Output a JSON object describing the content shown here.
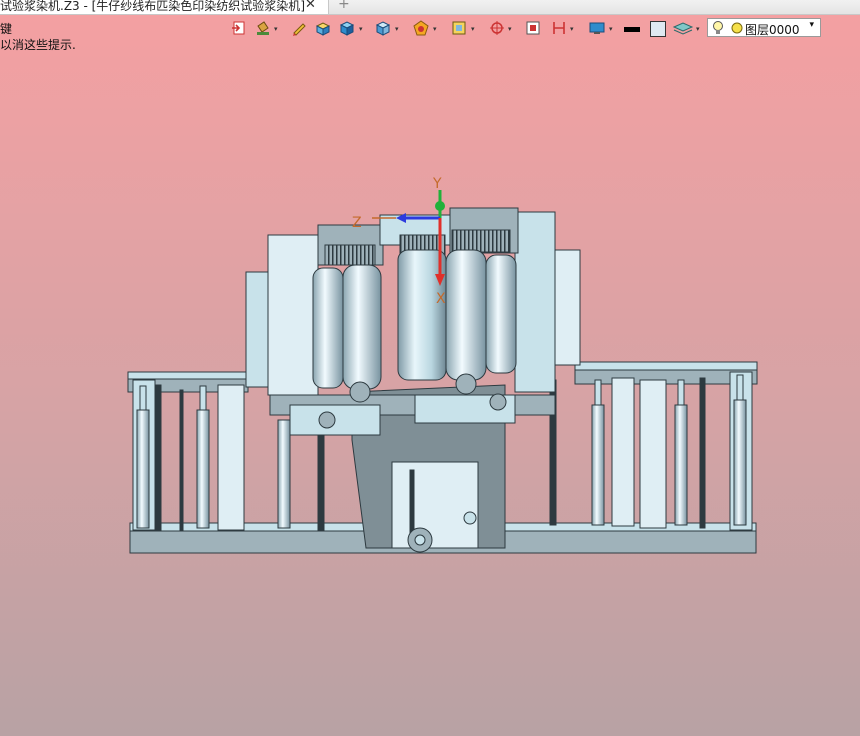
{
  "tab": {
    "title": "试验浆染机.Z3 - [牛仔纱线布匹染色印染纺织试验浆染机]",
    "close_glyph": "✕",
    "add_glyph": "+"
  },
  "hints": {
    "line1": "键",
    "line2": "以消这些提示."
  },
  "toolbar": {
    "layer_name": "图层0000",
    "dropdown_glyph": "▾",
    "icons": [
      "exit-icon",
      "paint-bucket-icon",
      "pencil-icon",
      "render-box-icon",
      "solid-cube-icon",
      "shaded-cube-icon",
      "wheel-icon",
      "frame-icon",
      "target-icon",
      "measure-icon",
      "align-icon",
      "display-icon",
      "line-color",
      "fill-color",
      "layer-stack-icon",
      "lightbulb-icon",
      "layer-color-dot"
    ]
  },
  "triad": {
    "x_label": "X",
    "y_label": "Y",
    "z_label": "Z"
  },
  "colors": {
    "bg_top": "#f5a0a2",
    "bg_bottom": "#b8a2a4",
    "model_fill": "#c8e2ea",
    "model_shade": "#8aa5b0",
    "model_frame": "#9fb2ba",
    "model_line": "#2d3a40",
    "axis_x": "#e0302a",
    "axis_y": "#21b13a",
    "axis_z": "#2c3bde",
    "label_color": "#c46a2c"
  }
}
